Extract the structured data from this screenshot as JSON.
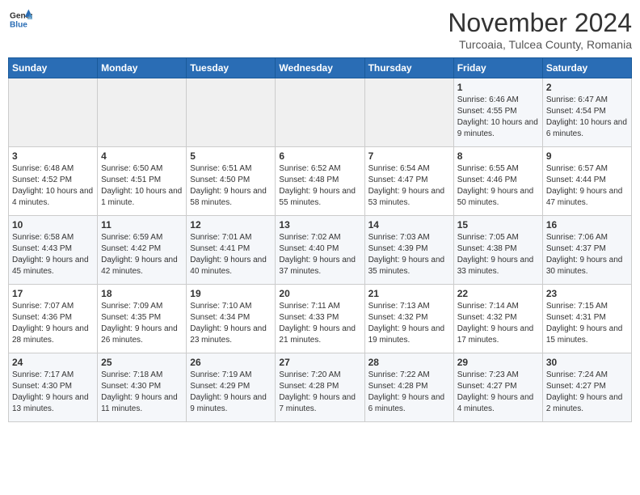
{
  "header": {
    "logo_general": "General",
    "logo_blue": "Blue",
    "month_title": "November 2024",
    "location": "Turcoaia, Tulcea County, Romania"
  },
  "weekdays": [
    "Sunday",
    "Monday",
    "Tuesday",
    "Wednesday",
    "Thursday",
    "Friday",
    "Saturday"
  ],
  "weeks": [
    [
      {
        "day": "",
        "info": ""
      },
      {
        "day": "",
        "info": ""
      },
      {
        "day": "",
        "info": ""
      },
      {
        "day": "",
        "info": ""
      },
      {
        "day": "",
        "info": ""
      },
      {
        "day": "1",
        "info": "Sunrise: 6:46 AM\nSunset: 4:55 PM\nDaylight: 10 hours and 9 minutes."
      },
      {
        "day": "2",
        "info": "Sunrise: 6:47 AM\nSunset: 4:54 PM\nDaylight: 10 hours and 6 minutes."
      }
    ],
    [
      {
        "day": "3",
        "info": "Sunrise: 6:48 AM\nSunset: 4:52 PM\nDaylight: 10 hours and 4 minutes."
      },
      {
        "day": "4",
        "info": "Sunrise: 6:50 AM\nSunset: 4:51 PM\nDaylight: 10 hours and 1 minute."
      },
      {
        "day": "5",
        "info": "Sunrise: 6:51 AM\nSunset: 4:50 PM\nDaylight: 9 hours and 58 minutes."
      },
      {
        "day": "6",
        "info": "Sunrise: 6:52 AM\nSunset: 4:48 PM\nDaylight: 9 hours and 55 minutes."
      },
      {
        "day": "7",
        "info": "Sunrise: 6:54 AM\nSunset: 4:47 PM\nDaylight: 9 hours and 53 minutes."
      },
      {
        "day": "8",
        "info": "Sunrise: 6:55 AM\nSunset: 4:46 PM\nDaylight: 9 hours and 50 minutes."
      },
      {
        "day": "9",
        "info": "Sunrise: 6:57 AM\nSunset: 4:44 PM\nDaylight: 9 hours and 47 minutes."
      }
    ],
    [
      {
        "day": "10",
        "info": "Sunrise: 6:58 AM\nSunset: 4:43 PM\nDaylight: 9 hours and 45 minutes."
      },
      {
        "day": "11",
        "info": "Sunrise: 6:59 AM\nSunset: 4:42 PM\nDaylight: 9 hours and 42 minutes."
      },
      {
        "day": "12",
        "info": "Sunrise: 7:01 AM\nSunset: 4:41 PM\nDaylight: 9 hours and 40 minutes."
      },
      {
        "day": "13",
        "info": "Sunrise: 7:02 AM\nSunset: 4:40 PM\nDaylight: 9 hours and 37 minutes."
      },
      {
        "day": "14",
        "info": "Sunrise: 7:03 AM\nSunset: 4:39 PM\nDaylight: 9 hours and 35 minutes."
      },
      {
        "day": "15",
        "info": "Sunrise: 7:05 AM\nSunset: 4:38 PM\nDaylight: 9 hours and 33 minutes."
      },
      {
        "day": "16",
        "info": "Sunrise: 7:06 AM\nSunset: 4:37 PM\nDaylight: 9 hours and 30 minutes."
      }
    ],
    [
      {
        "day": "17",
        "info": "Sunrise: 7:07 AM\nSunset: 4:36 PM\nDaylight: 9 hours and 28 minutes."
      },
      {
        "day": "18",
        "info": "Sunrise: 7:09 AM\nSunset: 4:35 PM\nDaylight: 9 hours and 26 minutes."
      },
      {
        "day": "19",
        "info": "Sunrise: 7:10 AM\nSunset: 4:34 PM\nDaylight: 9 hours and 23 minutes."
      },
      {
        "day": "20",
        "info": "Sunrise: 7:11 AM\nSunset: 4:33 PM\nDaylight: 9 hours and 21 minutes."
      },
      {
        "day": "21",
        "info": "Sunrise: 7:13 AM\nSunset: 4:32 PM\nDaylight: 9 hours and 19 minutes."
      },
      {
        "day": "22",
        "info": "Sunrise: 7:14 AM\nSunset: 4:32 PM\nDaylight: 9 hours and 17 minutes."
      },
      {
        "day": "23",
        "info": "Sunrise: 7:15 AM\nSunset: 4:31 PM\nDaylight: 9 hours and 15 minutes."
      }
    ],
    [
      {
        "day": "24",
        "info": "Sunrise: 7:17 AM\nSunset: 4:30 PM\nDaylight: 9 hours and 13 minutes."
      },
      {
        "day": "25",
        "info": "Sunrise: 7:18 AM\nSunset: 4:30 PM\nDaylight: 9 hours and 11 minutes."
      },
      {
        "day": "26",
        "info": "Sunrise: 7:19 AM\nSunset: 4:29 PM\nDaylight: 9 hours and 9 minutes."
      },
      {
        "day": "27",
        "info": "Sunrise: 7:20 AM\nSunset: 4:28 PM\nDaylight: 9 hours and 7 minutes."
      },
      {
        "day": "28",
        "info": "Sunrise: 7:22 AM\nSunset: 4:28 PM\nDaylight: 9 hours and 6 minutes."
      },
      {
        "day": "29",
        "info": "Sunrise: 7:23 AM\nSunset: 4:27 PM\nDaylight: 9 hours and 4 minutes."
      },
      {
        "day": "30",
        "info": "Sunrise: 7:24 AM\nSunset: 4:27 PM\nDaylight: 9 hours and 2 minutes."
      }
    ]
  ]
}
